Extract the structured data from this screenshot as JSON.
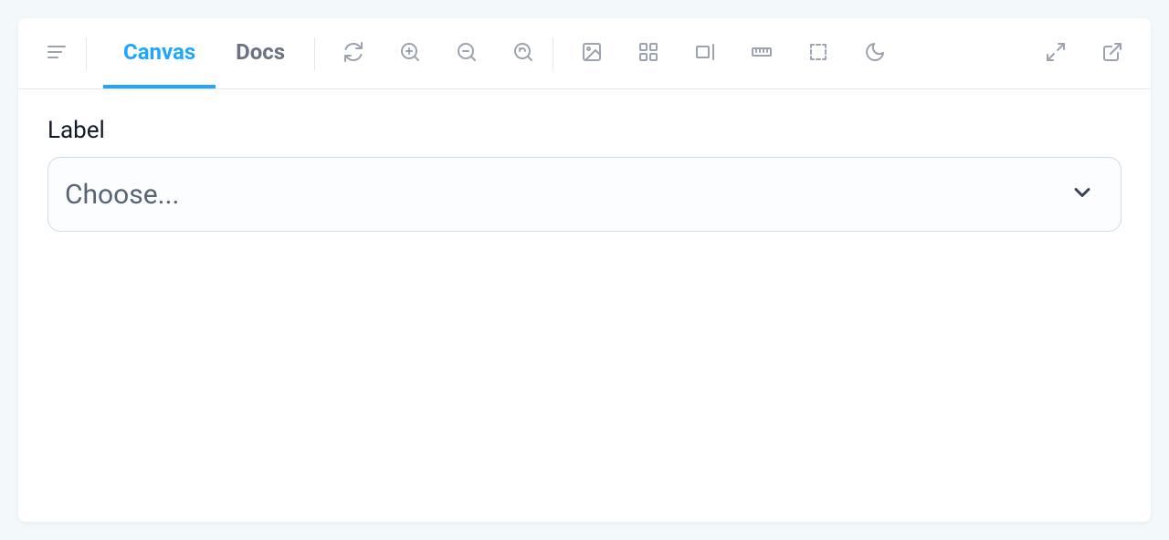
{
  "tabs": {
    "canvas": "Canvas",
    "docs": "Docs"
  },
  "field": {
    "label": "Label",
    "placeholder": "Choose..."
  }
}
